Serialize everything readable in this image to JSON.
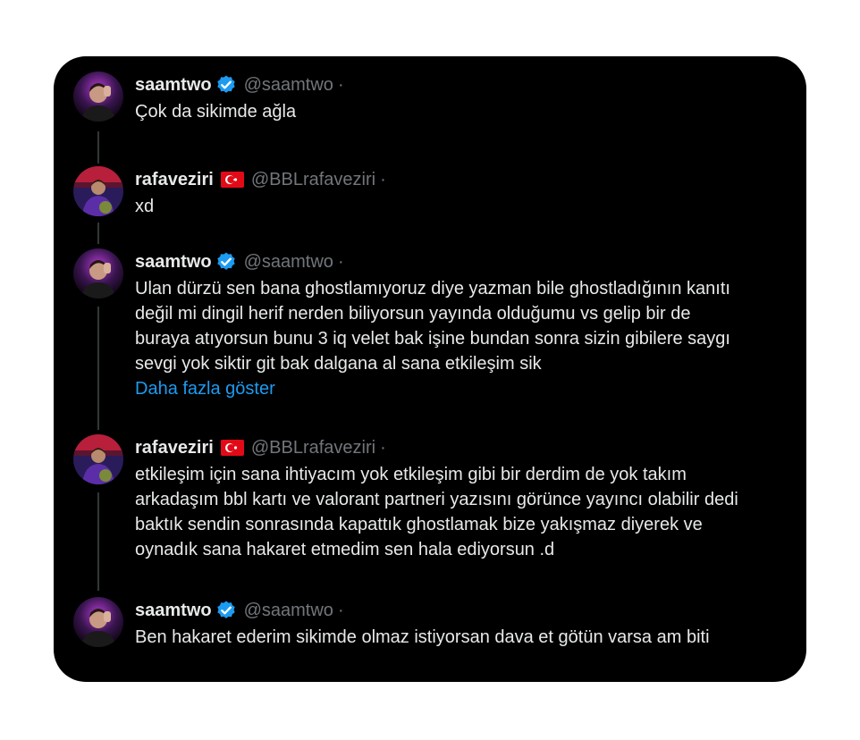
{
  "tweets": [
    {
      "name": "saamtwo",
      "handle": "@saamtwo",
      "sep": "·",
      "verified": true,
      "flag": false,
      "text": "Çok da sikimde ağla"
    },
    {
      "name": "rafaveziri",
      "handle": "@BBLrafaveziri",
      "sep": "·",
      "verified": false,
      "flag": true,
      "text": "xd"
    },
    {
      "name": "saamtwo",
      "handle": "@saamtwo",
      "sep": "·",
      "verified": true,
      "flag": false,
      "lines": [
        "Ulan dürzü sen bana ghostlamıyoruz diye yazman bile ghostladığının kanıtı",
        "değil mi dingil herif nerden biliyorsun yayında olduğumu vs gelip bir de",
        "buraya atıyorsun bunu 3 iq velet bak işine bundan sonra sizin gibilere saygı",
        "sevgi yok siktir git bak dalgana al sana etkileşim sik"
      ],
      "more": "Daha fazla göster"
    },
    {
      "name": "rafaveziri",
      "handle": "@BBLrafaveziri",
      "sep": "·",
      "verified": false,
      "flag": true,
      "lines": [
        "etkileşim için sana ihtiyacım yok etkileşim gibi bir derdim de yok takım",
        "arkadaşım bbl kartı ve valorant partneri yazısını görünce yayıncı olabilir dedi",
        "baktık sendin sonrasında kapattık ghostlamak bize yakışmaz diyerek ve",
        "oynadık sana hakaret etmedim sen hala ediyorsun .d"
      ]
    },
    {
      "name": "saamtwo",
      "handle": "@saamtwo",
      "sep": "·",
      "verified": true,
      "flag": false,
      "text": "Ben hakaret ederim sikimde olmaz istiyorsan dava et götün varsa am biti"
    }
  ],
  "colors": {
    "background": "#000000",
    "text": "#e7e9ea",
    "muted": "#71767b",
    "link": "#1d9bf0",
    "verified": "#1d9bf0",
    "flag": "#e30a17"
  }
}
